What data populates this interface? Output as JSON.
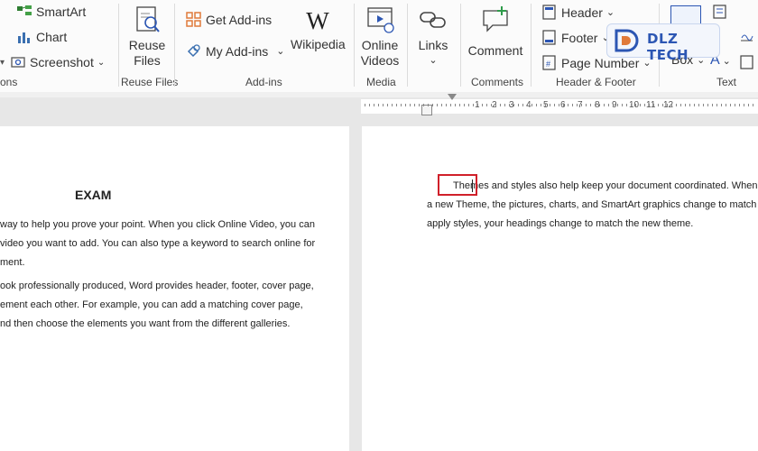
{
  "ribbon": {
    "illustrations": {
      "smartart": "SmartArt",
      "chart": "Chart",
      "screenshot": "Screenshot",
      "group_label_fragment": "ons"
    },
    "reuse_files": {
      "button": "Reuse Files",
      "group_label": "Reuse Files"
    },
    "addins": {
      "get_addins": "Get Add-ins",
      "my_addins": "My Add-ins",
      "wikipedia": "Wikipedia",
      "group_label": "Add-ins"
    },
    "media": {
      "online_videos": "Online Videos",
      "group_label": "Media"
    },
    "links": {
      "label": "Links"
    },
    "comments": {
      "comment": "Comment",
      "group_label": "Comments"
    },
    "header_footer": {
      "header": "Header",
      "footer": "Footer",
      "page_number": "Page Number",
      "group_label": "Header & Footer"
    },
    "text": {
      "text_box": "Box",
      "group_label": "Text"
    }
  },
  "watermark": {
    "brand": "DLZ TECH"
  },
  "ruler": {
    "numbers": [
      "1",
      "2",
      "3",
      "4",
      "5",
      "6",
      "7",
      "8",
      "9",
      "10",
      "11",
      "12"
    ]
  },
  "left_page": {
    "title": "EXAM",
    "lines": [
      "way to help you prove your point. When you click Online Video, you can",
      "video you want to add. You can also type a keyword to search online for",
      "ment.",
      "ook professionally produced, Word provides header, footer, cover page,",
      "ement each other. For example, you can add a matching cover page,",
      "nd then choose the elements you want from the different galleries."
    ]
  },
  "right_page": {
    "highlighted_word": "Themes",
    "line1_rest": " and styles also help keep your document coordinated. When you",
    "line2": "a new Theme, the pictures, charts, and SmartArt graphics change to match you",
    "line3": "apply styles, your headings change to match the new theme."
  },
  "colors": {
    "highlight_box": "#d0202a",
    "accent_orange": "#e07a3a",
    "accent_blue": "#2c56b3"
  }
}
